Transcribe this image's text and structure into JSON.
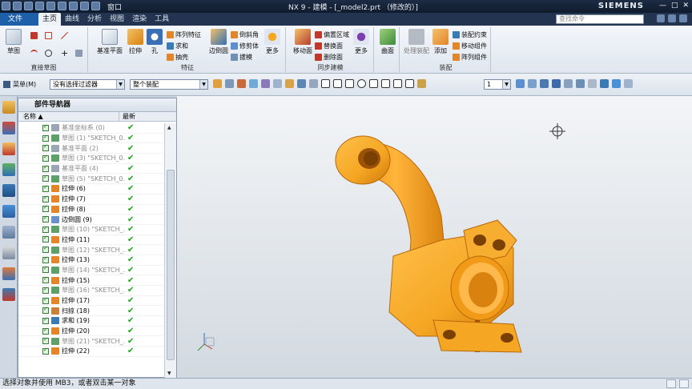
{
  "window": {
    "title": "NX 9 - 建模 - [_model2.prt （修改的）]",
    "brand": "SIEMENS",
    "window_menu": "窗口"
  },
  "menubar": {
    "file": "文件(F)",
    "tabs": [
      "主页",
      "曲线",
      "分析",
      "视图",
      "渲染",
      "工具"
    ],
    "active_tab": "主页",
    "search_placeholder": "查找命令"
  },
  "ribbon": {
    "sketch": "草图",
    "direct_sketch_label": "直接草图",
    "datum_plane": "基准平面",
    "extrude": "拉伸",
    "hole": "孔",
    "array_feature": "阵列特征",
    "unite": "求和",
    "shell": "抽壳",
    "edge_blend": "边倒圆",
    "chamfer": "倒斜角",
    "trim_body": "修剪体",
    "draft": "拔模",
    "more1": "更多",
    "feature_label": "特征",
    "move_face": "移动面",
    "offset_region": "偏置区域",
    "replace_face": "替换面",
    "delete_face": "删除面",
    "sync_label": "同步建模",
    "more2": "更多",
    "surface": "曲面",
    "process_assembly": "处理装配",
    "add": "添加",
    "assembly_constraint": "装配约束",
    "move_component": "移动组件",
    "array_component": "阵列组件",
    "assembly_label": "装配"
  },
  "toolbar": {
    "menu": "菜单(M)",
    "filter": "没有选择过滤器",
    "scope": "整个装配",
    "layer_value": "1"
  },
  "navigator": {
    "title": "部件导航器",
    "col_name": "名称",
    "col_latest": "最新",
    "rows": [
      {
        "name": "基准坐标系 (0)",
        "dim": true
      },
      {
        "name": "草图 (1) \"SKETCH_0...",
        "dim": true
      },
      {
        "name": "基准平面 (2)",
        "dim": true
      },
      {
        "name": "草图 (3) \"SKETCH_0...",
        "dim": true
      },
      {
        "name": "基准平面 (4)",
        "dim": true
      },
      {
        "name": "草图 (5) \"SKETCH_0...",
        "dim": true
      },
      {
        "name": "拉伸 (6)",
        "dim": false
      },
      {
        "name": "拉伸 (7)",
        "dim": false
      },
      {
        "name": "拉伸 (8)",
        "dim": false
      },
      {
        "name": "边倒圆 (9)",
        "dim": false
      },
      {
        "name": "草图 (10) \"SKETCH_...",
        "dim": true
      },
      {
        "name": "拉伸 (11)",
        "dim": false
      },
      {
        "name": "草图 (12) \"SKETCH_...",
        "dim": true
      },
      {
        "name": "拉伸 (13)",
        "dim": false
      },
      {
        "name": "草图 (14) \"SKETCH_...",
        "dim": true
      },
      {
        "name": "拉伸 (15)",
        "dim": false
      },
      {
        "name": "草图 (16) \"SKETCH_...",
        "dim": true
      },
      {
        "name": "拉伸 (17)",
        "dim": false
      },
      {
        "name": "扫掠 (18)",
        "dim": false
      },
      {
        "name": "求和 (19)",
        "dim": false
      },
      {
        "name": "拉伸 (20)",
        "dim": false
      },
      {
        "name": "草图 (21) \"SKETCH_...",
        "dim": true
      },
      {
        "name": "拉伸 (22)",
        "dim": false
      }
    ]
  },
  "status": {
    "text": "选择对象并使用 MB3，或者双击某一对象"
  },
  "colors": {
    "part": "#f5a623",
    "part_shadow": "#d9820c",
    "check": "#16a316"
  }
}
